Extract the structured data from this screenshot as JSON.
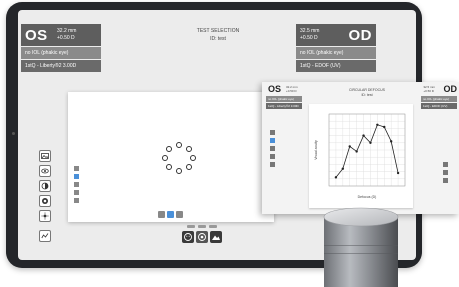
{
  "main_screen": {
    "os_panel": {
      "eye": "OS",
      "measurement": "32.2 mm",
      "power": "+0.50 D",
      "lens_type": "no IOL (phakic eye)",
      "iol_label": "1stQ - Liberty®2 3.00D"
    },
    "od_panel": {
      "eye": "OD",
      "measurement": "32.5 mm",
      "power": "+0.50 D",
      "lens_type": "no IOL (phakic eye)",
      "iol_label": "1stQ - EDOF (UV)"
    },
    "test_header": {
      "title": "TEST SELECTION",
      "subtitle": "ID: test"
    }
  },
  "second_window": {
    "os_eye": "OS",
    "os_measurement": "32.2 mm",
    "os_power": "+0.50 D",
    "os_lens_type": "no IOL (phakic eye)",
    "os_iol_label": "1stQ - Liberty®2 3.00D",
    "od_eye": "OD",
    "od_measurement": "32.5 mm",
    "od_power": "+0.50 D",
    "od_lens_type": "no IOL (phakic eye)",
    "od_iol_label": "1stQ - EDOF (UV)",
    "title": "CIRCULAR DEFOCUS",
    "subtitle": "ID: test"
  },
  "chart_data": {
    "type": "line",
    "title": "",
    "xlabel": "Defocus (D)",
    "ylabel": "Visual acuity",
    "x": [
      1,
      2,
      3,
      4,
      5,
      6,
      7,
      8,
      9,
      10
    ],
    "values": [
      0.12,
      0.24,
      0.55,
      0.48,
      0.7,
      0.6,
      0.85,
      0.82,
      0.62,
      0.18
    ],
    "series": [
      {
        "values": [
          0.12,
          0.24,
          0.55,
          0.48,
          0.7,
          0.6,
          0.85,
          0.82,
          0.62,
          0.18
        ]
      }
    ],
    "xlim": [
      0,
      11
    ],
    "ylim": [
      0,
      1
    ],
    "grid": true
  },
  "icons": {
    "toolbar": [
      "image-icon",
      "eye-icon",
      "contrast-icon",
      "circle-fill-icon",
      "sun-icon",
      "graph-icon"
    ],
    "bottom": [
      "face-icon",
      "target-icon",
      "mountain-icon"
    ]
  },
  "colors": {
    "panel": "#5e5e5e",
    "accent": "#4a90d9",
    "tablet": "#24262a"
  }
}
